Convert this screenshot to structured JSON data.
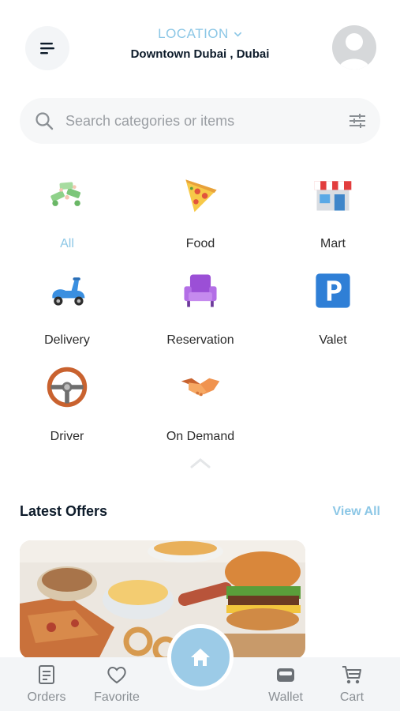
{
  "header": {
    "location_label": "LOCATION",
    "location_value": "Downtown Dubai , Dubai"
  },
  "search": {
    "placeholder": "Search categories or items"
  },
  "categories": [
    {
      "label": "All",
      "icon": "all-icon",
      "active": true
    },
    {
      "label": "Food",
      "icon": "pizza-icon"
    },
    {
      "label": "Mart",
      "icon": "store-icon"
    },
    {
      "label": "Delivery",
      "icon": "scooter-icon"
    },
    {
      "label": "Reservation",
      "icon": "armchair-icon"
    },
    {
      "label": "Valet",
      "icon": "parking-icon"
    },
    {
      "label": "Driver",
      "icon": "steering-wheel-icon"
    },
    {
      "label": "On Demand",
      "icon": "handshake-icon"
    }
  ],
  "offers": {
    "title": "Latest Offers",
    "view_all": "View All"
  },
  "nav": {
    "orders": "Orders",
    "favorite": "Favorite",
    "wallet": "Wallet",
    "cart": "Cart"
  },
  "colors": {
    "accent": "#8cc7e6",
    "home_button": "#9ccbe7",
    "text_dark": "#0d1b2a"
  }
}
